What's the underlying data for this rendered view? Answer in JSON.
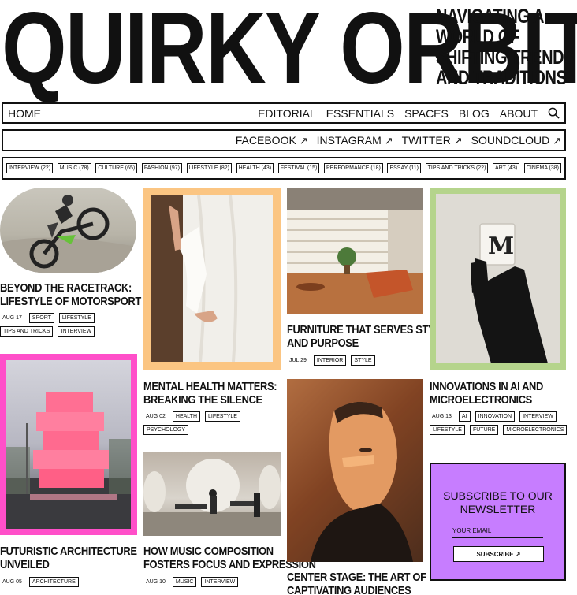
{
  "brand": "QUIRKY ORBIT",
  "tagline": [
    "NAVIGATING A",
    "WORLD OF",
    "SHIFTING TRENDS",
    "AND TRADITIONS"
  ],
  "nav": {
    "home": "HOME",
    "links": [
      "EDITORIAL",
      "ESSENTIALS",
      "SPACES",
      "BLOG",
      "ABOUT"
    ],
    "search_icon": "search-icon"
  },
  "social": [
    "FACEBOOK",
    "INSTAGRAM",
    "TWITTER",
    "SOUNDCLOUD"
  ],
  "social_arrow": "↗",
  "tags": [
    "INTERVIEW (22)",
    "MUSIC (78)",
    "CULTURE (65)",
    "FASHION (97)",
    "LIFESTYLE (82)",
    "HEALTH (43)",
    "FESTIVAL (15)",
    "PERFORMANCE (18)",
    "ESSAY (11)",
    "TIPS AND TRICKS (22)",
    "ART (43)",
    "CINEMA (38)"
  ],
  "colors": {
    "orange_frame": "#fbc582",
    "green_frame": "#b5d48c",
    "pink_frame": "#ff4fc9",
    "newsletter_bg": "#c77dff"
  },
  "posts": {
    "motorsport": {
      "title1": "BEYOND THE RACETRACK:",
      "title2": "LIFESTYLE OF MOTORSPORT",
      "date": "AUG 17",
      "chips": [
        "SPORT",
        "LIFESTYLE",
        "TIPS AND TRICKS",
        "INTERVIEW"
      ]
    },
    "mental": {
      "title1": "MENTAL HEALTH MATTERS:",
      "title2": "BREAKING THE SILENCE",
      "date": "AUG 02",
      "chips": [
        "HEALTH",
        "LIFESTYLE",
        "PSYCHOLOGY"
      ]
    },
    "furniture": {
      "title1": "FURNITURE THAT SERVES STYLE",
      "title2": "AND PURPOSE",
      "date": "JUL 29",
      "chips": [
        "INTERIOR",
        "STYLE"
      ]
    },
    "ai": {
      "title1": "INNOVATIONS IN AI AND",
      "title2": "MICROELECTRONICS",
      "date": "AUG 13",
      "chips": [
        "AI",
        "INNOVATION",
        "INTERVIEW",
        "LIFESTYLE",
        "FUTURE",
        "MICROELECTRONICS"
      ]
    },
    "architecture": {
      "title1": "FUTURISTIC ARCHITECTURE",
      "title2": "UNVEILED",
      "date": "AUG 05",
      "chips": [
        "ARCHITECTURE"
      ]
    },
    "music": {
      "title1": "HOW MUSIC COMPOSITION",
      "title2": "FOSTERS FOCUS AND EXPRESSION",
      "date": "AUG 10",
      "chips": [
        "MUSIC",
        "INTERVIEW"
      ]
    },
    "stage": {
      "title1": "CENTER STAGE: THE ART OF",
      "title2": "CAPTIVATING AUDIENCES"
    }
  },
  "newsletter": {
    "title1": "SUBSCRIBE TO OUR",
    "title2": "NEWSLETTER",
    "email_label": "YOUR EMAIL",
    "button": "SUBSCRIBE ↗"
  }
}
